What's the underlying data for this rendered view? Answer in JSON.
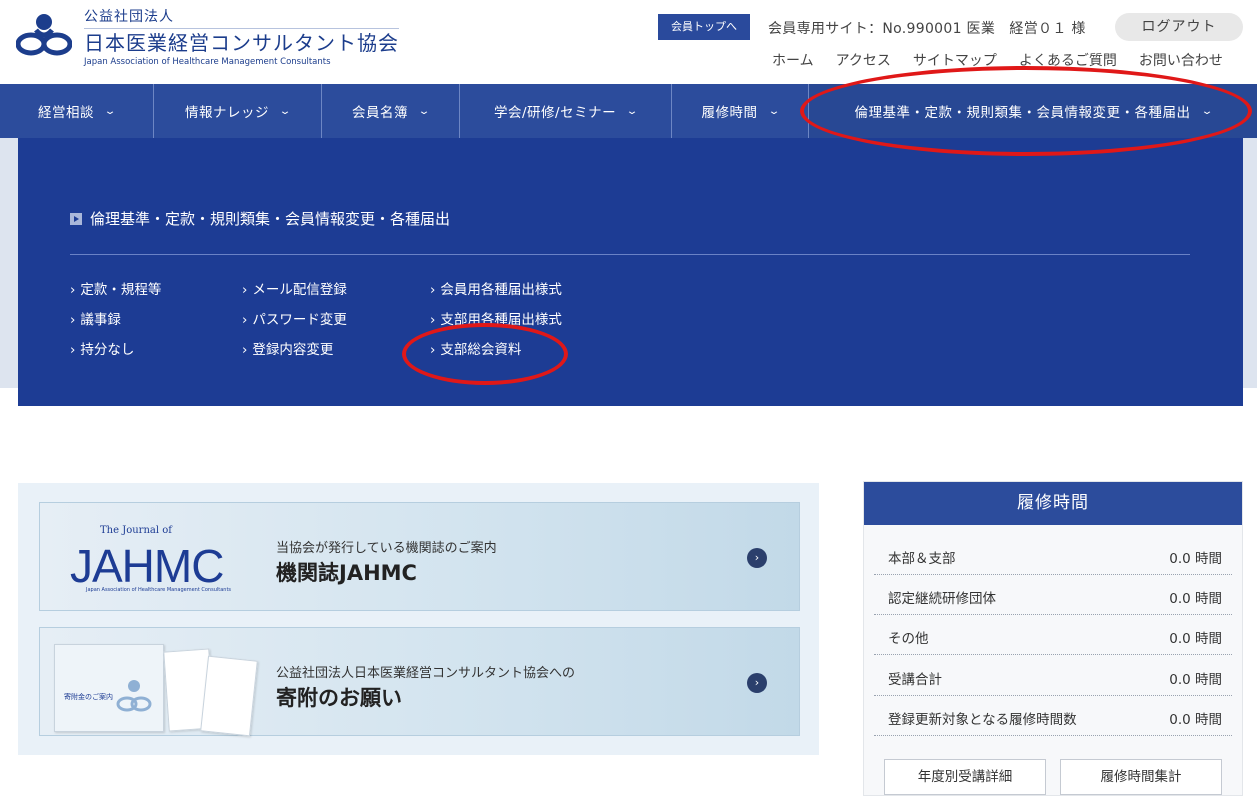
{
  "header": {
    "org_type": "公益社団法人",
    "org_name": "日本医業経営コンサルタント協会",
    "org_name_en": "Japan Association of Healthcare Management Consultants",
    "member_top_button": "会員トップへ",
    "member_info": "会員専用サイト：No.990001 医業　経営０１ 様",
    "logout_button": "ログアウト",
    "util_nav": [
      "ホーム",
      "アクセス",
      "サイトマップ",
      "よくあるご質問",
      "お問い合わせ"
    ]
  },
  "global_nav": {
    "items": [
      {
        "label": "経営相談"
      },
      {
        "label": "情報ナレッジ"
      },
      {
        "label": "会員名簿"
      },
      {
        "label": "学会/研修/セミナー"
      },
      {
        "label": "履修時間"
      },
      {
        "label": "倫理基準・定款・規則類集・会員情報変更・各種届出"
      }
    ],
    "chevron": "⌄"
  },
  "dropdown": {
    "title": "倫理基準・定款・規則類集・会員情報変更・各種届出",
    "col1": [
      "定款・規程等",
      "議事録",
      "持分なし"
    ],
    "col2": [
      "メール配信登録",
      "パスワード変更",
      "登録内容変更"
    ],
    "col3": [
      "会員用各種届出様式",
      "支部用各種届出様式",
      "支部総会資料"
    ]
  },
  "banners": [
    {
      "logo_small": "The Journal of",
      "logo_big": "JAHMC",
      "logo_tiny": "Japan Association of Healthcare Management Consultants",
      "subtitle": "当協会が発行している機関誌のご案内",
      "title": "機関誌JAHMC",
      "arrow": "›"
    },
    {
      "paper_label": "寄附金のご案内",
      "subtitle": "公益社団法人日本医業経営コンサルタント協会への",
      "title": "寄附のお願い",
      "arrow": "›"
    }
  ],
  "side_panel": {
    "title": "履修時間",
    "rows": [
      {
        "label": "本部＆支部",
        "value": "0.0 時間"
      },
      {
        "label": "認定継続研修団体",
        "value": "0.0 時間"
      },
      {
        "label": "その他",
        "value": "0.0 時間"
      },
      {
        "label": "受講合計",
        "value": "0.0 時間"
      },
      {
        "label": "登録更新対象となる履修時間数",
        "value": "0.0 時間"
      }
    ],
    "buttons": [
      "年度別受講詳細",
      "履修時間集計"
    ]
  },
  "colors": {
    "nav_blue": "#2c4c9c",
    "dropdown_blue": "#1d3c94",
    "annotation_red": "#e01818"
  }
}
